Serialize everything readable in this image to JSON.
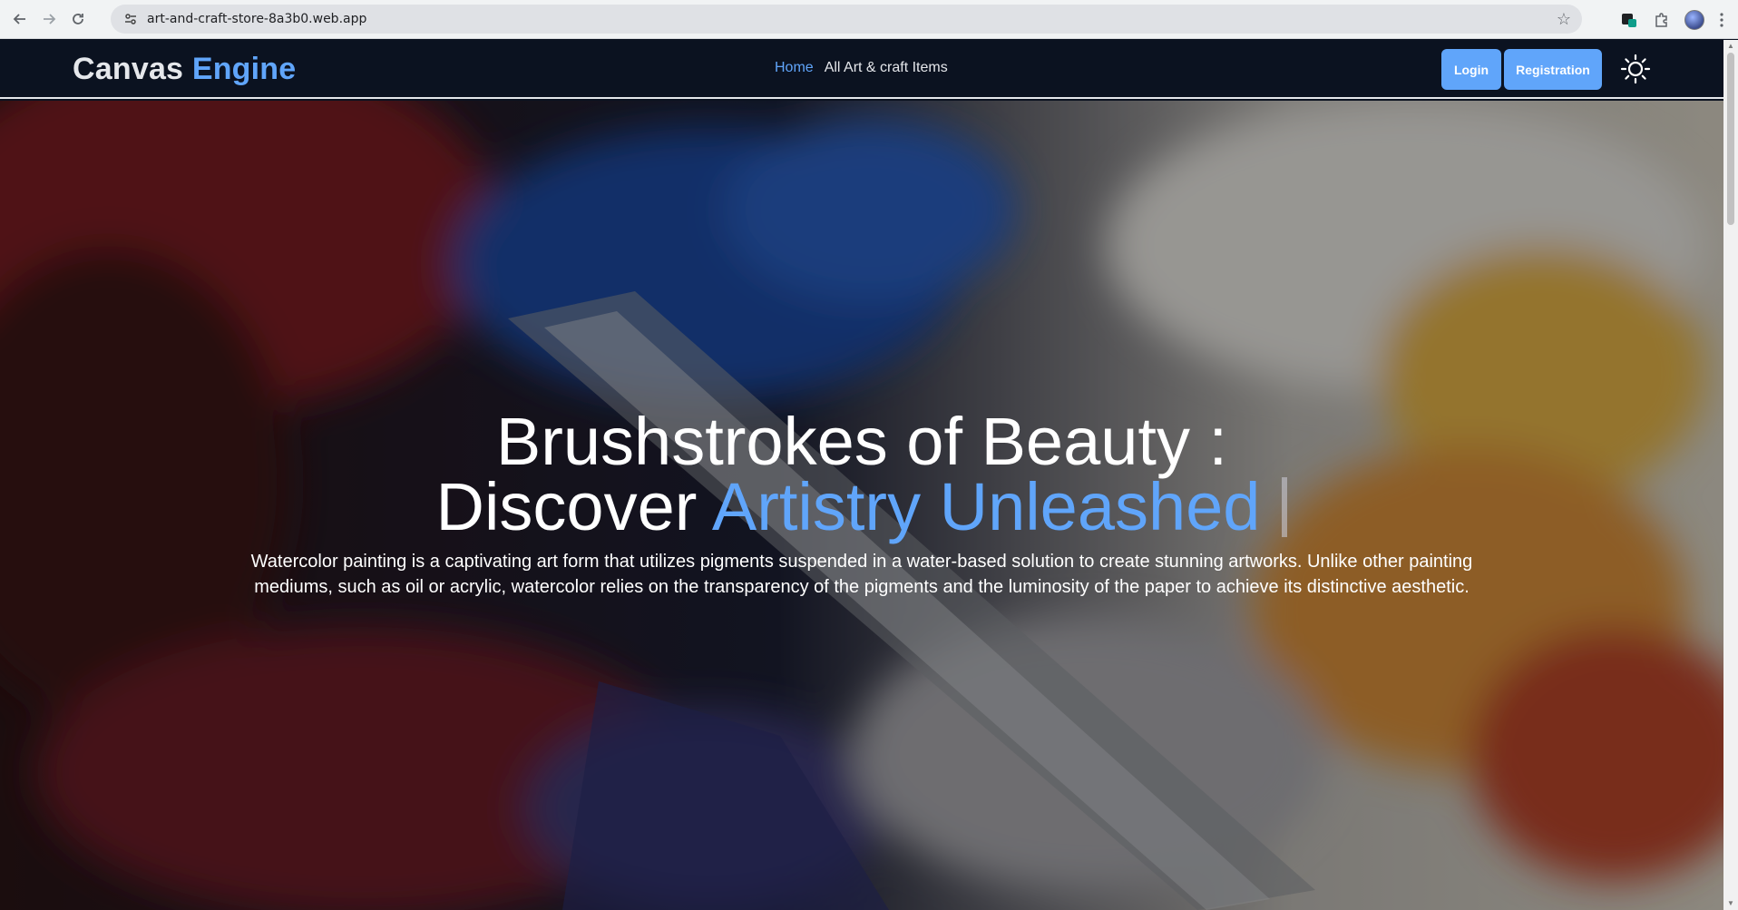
{
  "browser": {
    "url": "art-and-craft-store-8a3b0.web.app",
    "icons": [
      "back-icon",
      "forward-icon",
      "reload-icon",
      "site-settings-icon",
      "bookmark-star-icon",
      "extension-icon",
      "puzzle-icon",
      "profile-avatar",
      "more-icon"
    ]
  },
  "header": {
    "brand_part1": "Canvas",
    "brand_part2": "Engine",
    "nav": [
      {
        "label": "Home",
        "active": true
      },
      {
        "label": "All Art & craft Items",
        "active": false
      }
    ],
    "login_label": "Login",
    "registration_label": "Registration",
    "theme_icon": "sun-icon"
  },
  "hero": {
    "title_line1": "Brushstrokes of Beauty :",
    "title_line2_plain": "Discover",
    "title_line2_accent": "Artistry Unleashed",
    "description": "Watercolor painting is a captivating art form that utilizes pigments suspended in a water-based solution to create stunning artworks. Unlike other painting mediums, such as oil or acrylic, watercolor relies on the transparency of the pigments and the luminosity of the paper to achieve its distinctive aesthetic."
  },
  "colors": {
    "accent": "#60a5fa",
    "nav_bg": "#0b1220"
  }
}
